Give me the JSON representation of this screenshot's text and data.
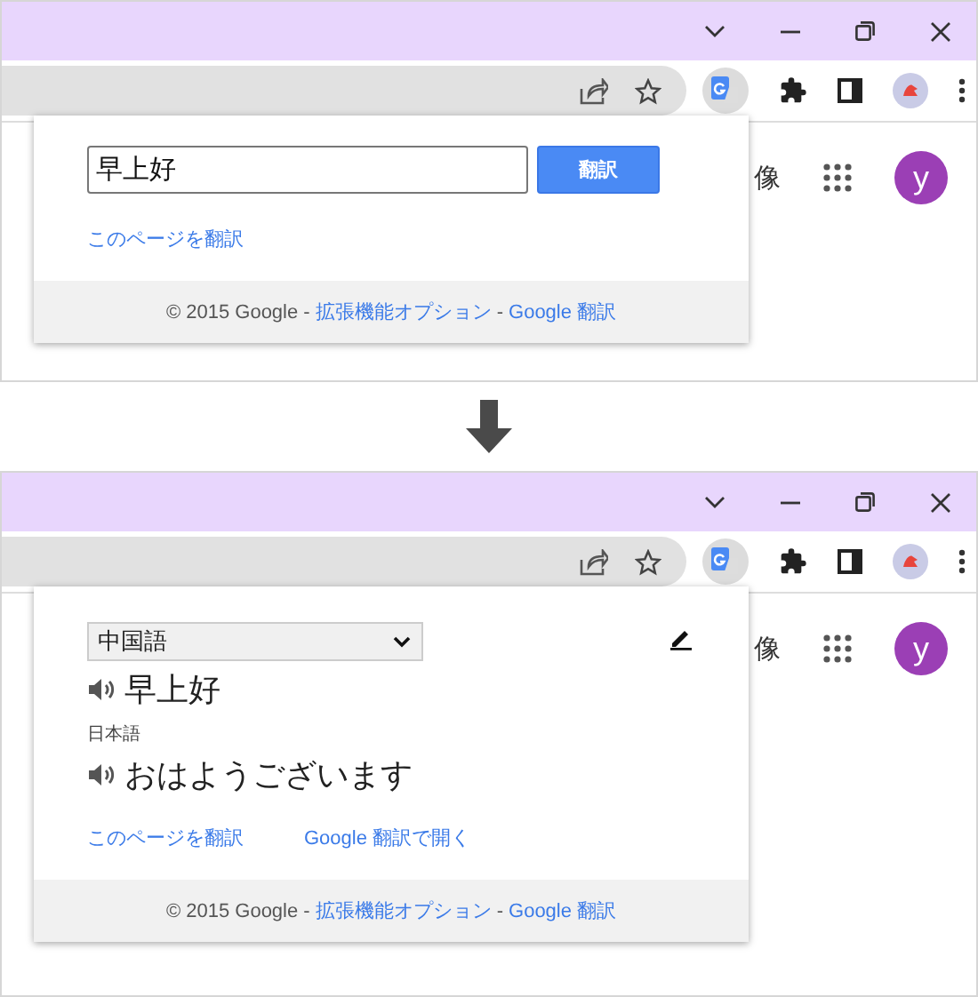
{
  "panels": [
    {
      "kind": "input",
      "page": {
        "image_link": "像",
        "avatar": "y"
      },
      "popup": {
        "input_value": "早上好",
        "translate_button": "翻訳",
        "links": [
          "このページを翻訳"
        ],
        "footer": {
          "copyright": "© 2015 Google -",
          "options_link": "拡張機能オプション",
          "separator": "-",
          "translate_link": "Google 翻訳"
        }
      }
    },
    {
      "kind": "result",
      "page": {
        "image_link": "像",
        "avatar": "y"
      },
      "popup": {
        "source_language": "中国語",
        "source_text": "早上好",
        "target_language": "日本語",
        "translation": "おはようございます",
        "links": [
          "このページを翻訳",
          "Google 翻訳で開く"
        ],
        "footer": {
          "copyright": "© 2015 Google -",
          "options_link": "拡張機能オプション",
          "separator": "-",
          "translate_link": "Google 翻訳"
        }
      }
    }
  ]
}
